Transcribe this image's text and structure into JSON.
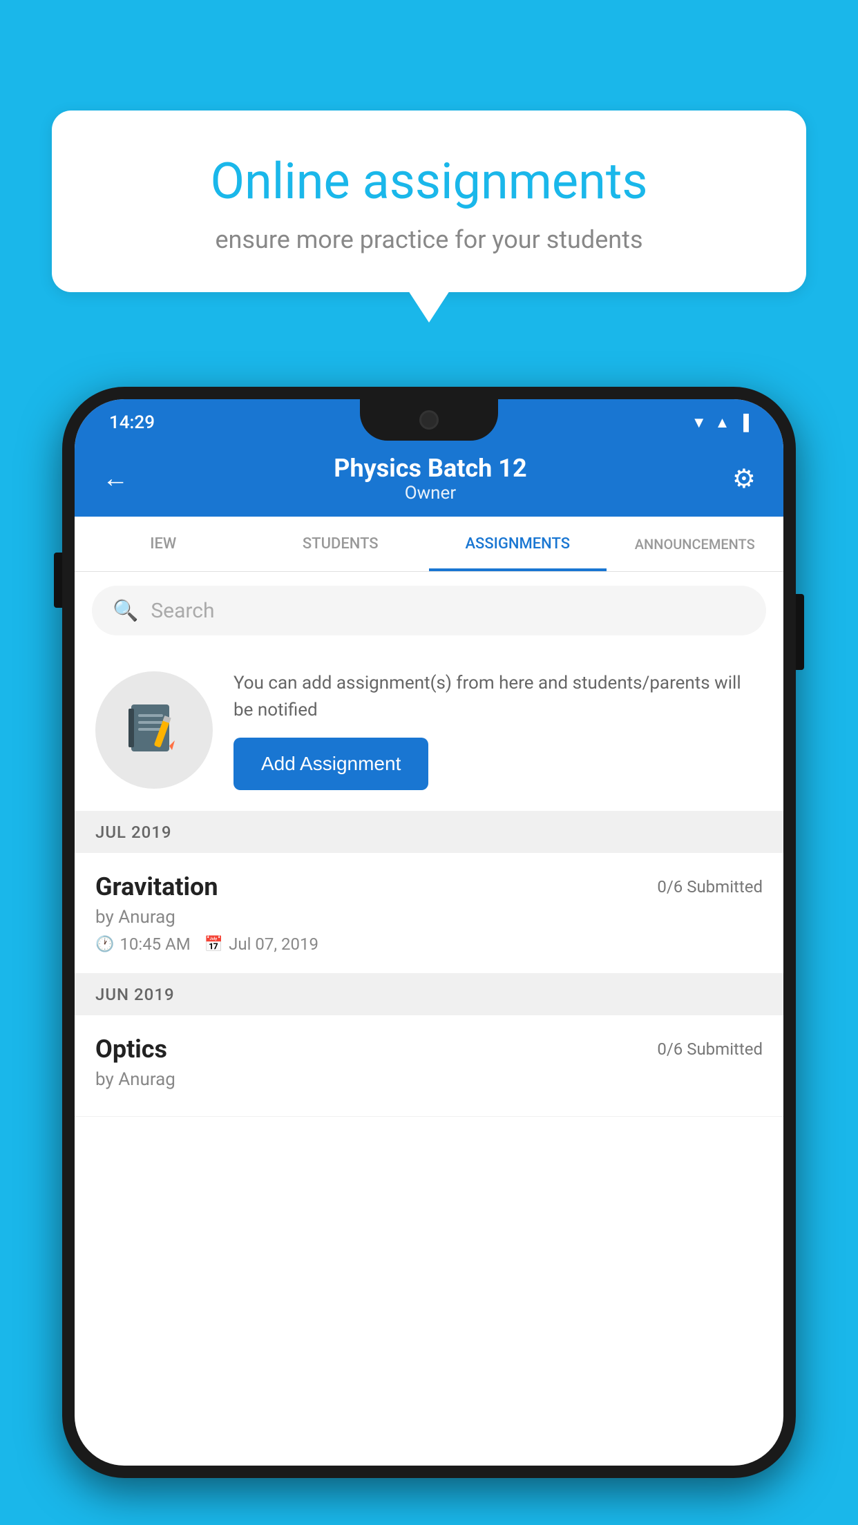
{
  "background_color": "#1ab7ea",
  "speech_bubble": {
    "title": "Online assignments",
    "subtitle": "ensure more practice for your students"
  },
  "status_bar": {
    "time": "14:29",
    "wifi": "▼",
    "signal": "▲",
    "battery": "▐"
  },
  "header": {
    "title": "Physics Batch 12",
    "subtitle": "Owner",
    "back_label": "←",
    "settings_label": "⚙"
  },
  "tabs": [
    {
      "id": "iew",
      "label": "IEW",
      "active": false
    },
    {
      "id": "students",
      "label": "STUDENTS",
      "active": false
    },
    {
      "id": "assignments",
      "label": "ASSIGNMENTS",
      "active": true
    },
    {
      "id": "announcements",
      "label": "ANNOUNCEMENTS",
      "active": false
    }
  ],
  "search": {
    "placeholder": "Search"
  },
  "add_assignment": {
    "description": "You can add assignment(s) from here and students/parents will be notified",
    "button_label": "Add Assignment"
  },
  "sections": [
    {
      "label": "JUL 2019",
      "assignments": [
        {
          "name": "Gravitation",
          "submitted": "0/6 Submitted",
          "by": "by Anurag",
          "time": "10:45 AM",
          "date": "Jul 07, 2019"
        }
      ]
    },
    {
      "label": "JUN 2019",
      "assignments": [
        {
          "name": "Optics",
          "submitted": "0/6 Submitted",
          "by": "by Anurag",
          "time": "",
          "date": ""
        }
      ]
    }
  ]
}
